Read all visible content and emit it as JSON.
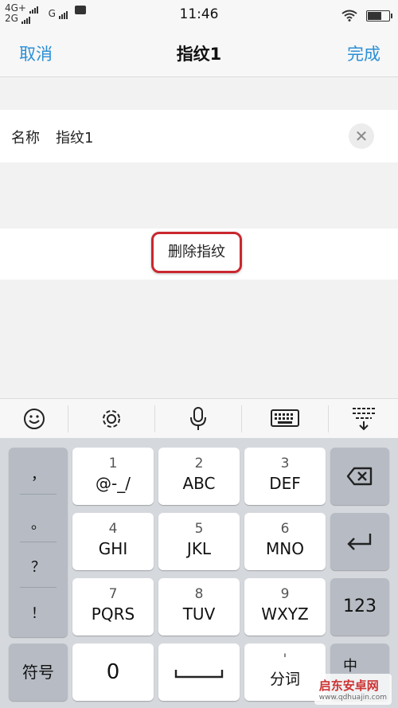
{
  "status_bar": {
    "network_primary": "4G+",
    "network_secondary": "2G",
    "network_third": "G",
    "time": "11:46"
  },
  "nav": {
    "cancel_label": "取消",
    "title": "指纹1",
    "done_label": "完成"
  },
  "name_field": {
    "label": "名称",
    "value": "指纹1"
  },
  "delete_button_label": "删除指纹",
  "keyboard": {
    "toolbar_icons": [
      "emoji-icon",
      "settings-icon",
      "microphone-icon",
      "keyboard-icon",
      "hide-keyboard-icon"
    ],
    "punctuation": [
      "，",
      "。",
      "？",
      "！"
    ],
    "keys": [
      {
        "num": "1",
        "letters": "@-_/"
      },
      {
        "num": "2",
        "letters": "ABC"
      },
      {
        "num": "3",
        "letters": "DEF"
      },
      {
        "num": "4",
        "letters": "GHI"
      },
      {
        "num": "5",
        "letters": "JKL"
      },
      {
        "num": "6",
        "letters": "MNO"
      },
      {
        "num": "7",
        "letters": "PQRS"
      },
      {
        "num": "8",
        "letters": "TUV"
      },
      {
        "num": "9",
        "letters": "WXYZ"
      }
    ],
    "symbols_label": "符号",
    "zero_label": "0",
    "segment_label": "分词",
    "numbers_label": "123",
    "lang_label": "中"
  },
  "watermark": {
    "title": "启东安卓网",
    "url": "www.qdhuajin.com"
  },
  "colors": {
    "accent": "#2a8fd6",
    "highlight_border": "#c9272f",
    "keyboard_bg": "#d5d8dd"
  }
}
